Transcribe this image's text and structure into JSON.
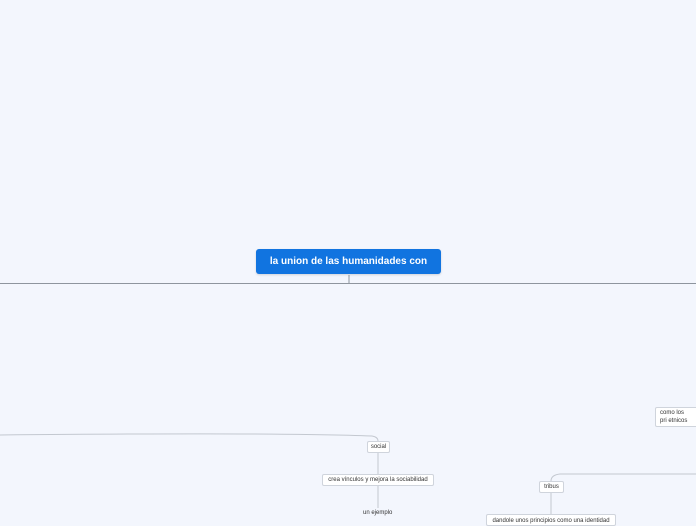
{
  "mindmap": {
    "root": {
      "label": "la union de las humanidades con"
    },
    "nodes": {
      "social": "social",
      "crea": "crea vínculos y mejora la sociabilidad",
      "ejemplo": "un ejemplo",
      "tribus": "tribus",
      "dandole": "dandole unos principios como una identidad",
      "como": "como los pri etnicos"
    }
  },
  "colors": {
    "background": "#f3f6fd",
    "root_fill": "#1174e0",
    "connector": "#8e959e",
    "node_border": "#cfd4dc"
  }
}
